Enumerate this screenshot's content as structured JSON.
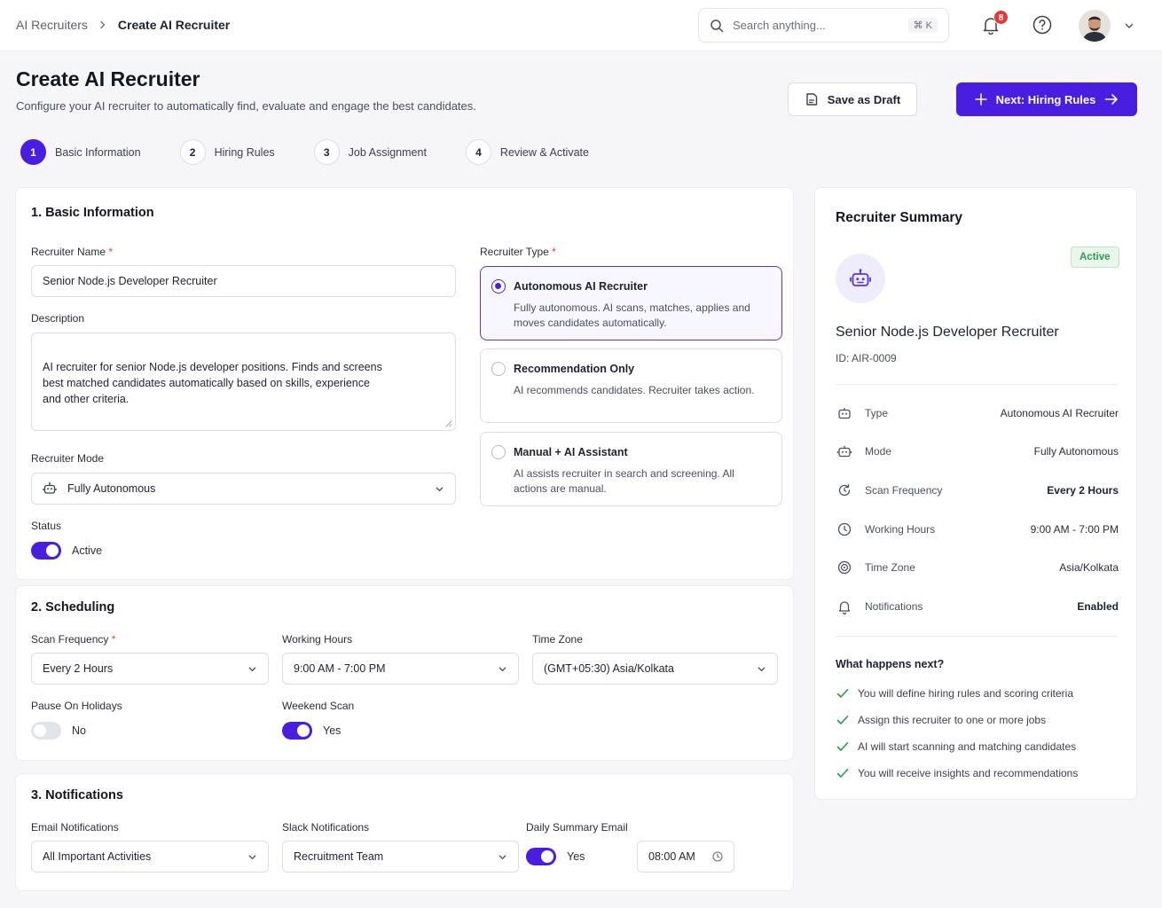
{
  "breadcrumb": {
    "parent": "AI Recruiters",
    "current": "Create AI Recruiter"
  },
  "search": {
    "placeholder": "Search anything...",
    "shortcut": "⌘ K"
  },
  "notifications": {
    "count": "8"
  },
  "header": {
    "title": "Create AI Recruiter",
    "subtitle": "Configure your AI recruiter to automatically find, evaluate and engage the best candidates.",
    "save_draft": "Save as Draft",
    "next": "Next: Hiring Rules"
  },
  "steps": [
    {
      "num": "1",
      "label": "Basic Information"
    },
    {
      "num": "2",
      "label": "Hiring Rules"
    },
    {
      "num": "3",
      "label": "Job Assignment"
    },
    {
      "num": "4",
      "label": "Review & Activate"
    }
  ],
  "basic": {
    "title": "1. Basic Information",
    "name_label": "Recruiter Name",
    "name_value": "Senior Node.js Developer Recruiter",
    "desc_label": "Description",
    "desc_value": "AI recruiter for senior Node.js developer positions. Finds and screens\nbest matched candidates automatically based on skills, experience\nand other criteria.",
    "mode_label": "Recruiter Mode",
    "mode_value": "Fully Autonomous",
    "status_label": "Status",
    "status_value": "Active",
    "type_label": "Recruiter Type",
    "types": [
      {
        "title": "Autonomous AI Recruiter",
        "desc": "Fully autonomous. AI scans, matches, applies and moves candidates automatically."
      },
      {
        "title": "Recommendation Only",
        "desc": "AI recommends candidates. Recruiter takes action."
      },
      {
        "title": "Manual + AI Assistant",
        "desc": "AI assists recruiter in search and screening. All actions are manual."
      }
    ]
  },
  "scheduling": {
    "title": "2. Scheduling",
    "freq_label": "Scan Frequency",
    "freq_value": "Every 2 Hours",
    "hours_label": "Working Hours",
    "hours_value": "9:00 AM - 7:00 PM",
    "tz_label": "Time Zone",
    "tz_value": "(GMT+05:30) Asia/Kolkata",
    "holidays_label": "Pause On Holidays",
    "holidays_value": "No",
    "weekend_label": "Weekend Scan",
    "weekend_value": "Yes"
  },
  "notif": {
    "title": "3. Notifications",
    "email_label": "Email Notifications",
    "email_value": "All Important Activities",
    "slack_label": "Slack Notifications",
    "slack_value": "Recruitment Team",
    "daily_label": "Daily Summary Email",
    "daily_value": "Yes",
    "daily_time": "08:00 AM"
  },
  "summary": {
    "title": "Recruiter Summary",
    "badge": "Active",
    "name": "Senior Node.js Developer Recruiter",
    "id": "ID: AIR-0009",
    "rows": [
      {
        "label": "Type",
        "value": "Autonomous AI Recruiter",
        "icon": "robot-icon"
      },
      {
        "label": "Mode",
        "value": "Fully Autonomous",
        "icon": "robot-icon"
      },
      {
        "label": "Scan Frequency",
        "value": "Every 2 Hours",
        "icon": "refresh-icon"
      },
      {
        "label": "Working Hours",
        "value": "9:00 AM - 7:00 PM",
        "icon": "clock-icon"
      },
      {
        "label": "Time Zone",
        "value": "Asia/Kolkata",
        "icon": "globe-icon"
      },
      {
        "label": "Notifications",
        "value": "Enabled",
        "icon": "bell-icon"
      }
    ],
    "next_title": "What happens next?",
    "next_items": [
      "You will define hiring rules and scoring criteria",
      "Assign this recruiter to one or more jobs",
      "AI will start scanning and matching candidates",
      "You will receive insights and recommendations"
    ]
  },
  "colors": {
    "accent": "#4a1ee0",
    "badge_green": "#2e9a4f",
    "danger": "#e53935"
  }
}
